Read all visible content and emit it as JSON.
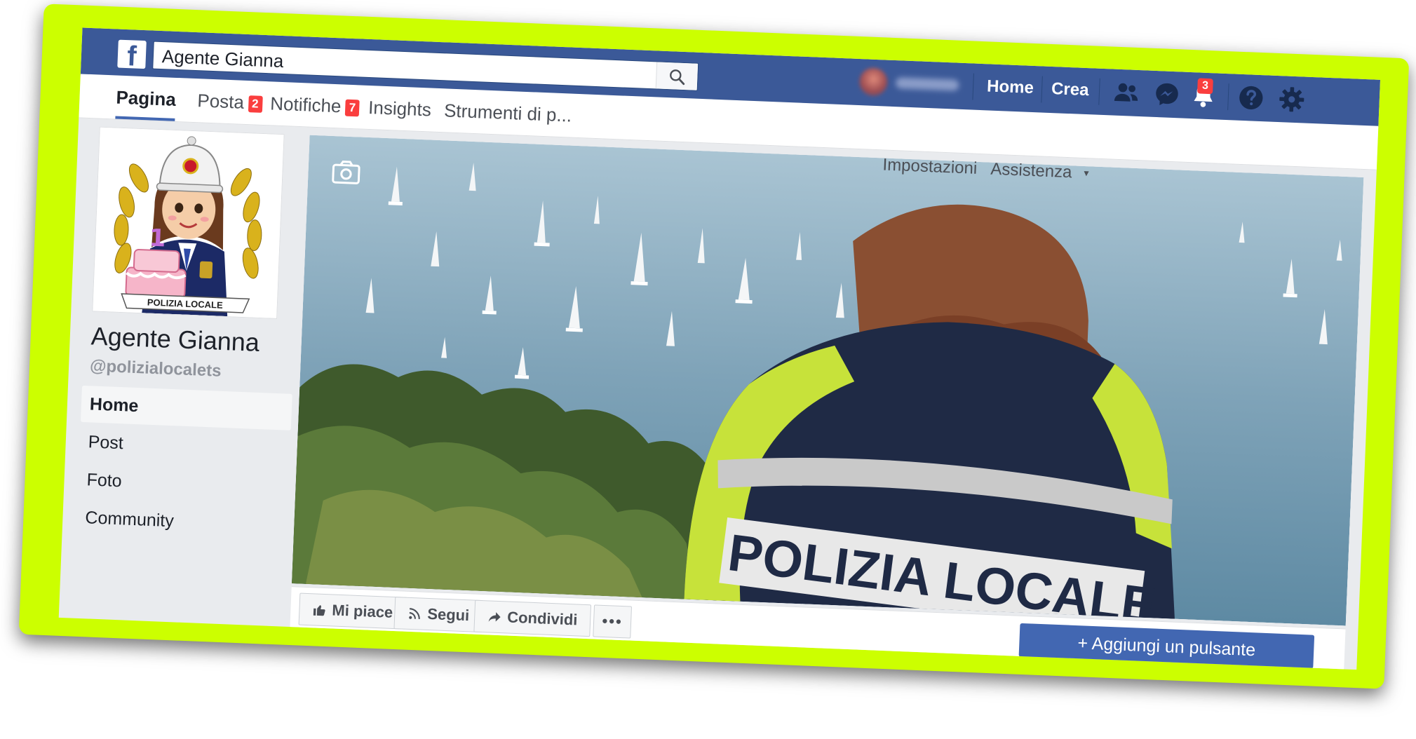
{
  "topbar": {
    "logo": "f",
    "search_value": "Agente Gianna",
    "nav_home": "Home",
    "nav_crea": "Crea",
    "notification_count": "3",
    "icons": [
      "search-icon",
      "friends-icon",
      "messenger-icon",
      "bell-icon",
      "help-icon",
      "gear-icon"
    ]
  },
  "tabs": {
    "pagina": "Pagina",
    "posta": "Posta",
    "posta_count": "2",
    "notifiche": "Notifiche",
    "notifiche_count": "7",
    "insights": "Insights",
    "strumenti": "Strumenti di p...",
    "impostazioni": "Impostazioni",
    "assistenza": "Assistenza",
    "assistenza_caret": "▼"
  },
  "profile": {
    "name": "Agente Gianna",
    "handle": "@polizialocalets",
    "badge_text": "POLIZIA LOCALE",
    "cake_number": "1"
  },
  "left_nav": {
    "home": "Home",
    "post": "Post",
    "foto": "Foto",
    "community": "Community"
  },
  "cover": {
    "vest_text": "POLIZIA LOCALE"
  },
  "actions": {
    "mi_piace": "Mi piace",
    "segui": "Segui",
    "condividi": "Condividi",
    "more": "•••",
    "aggiungi": "+ Aggiungi un pulsante"
  },
  "colors": {
    "frame": "#ccff00",
    "facebook_blue": "#3b5998",
    "button_blue": "#4267b2",
    "badge_red": "#fa3e3e"
  }
}
